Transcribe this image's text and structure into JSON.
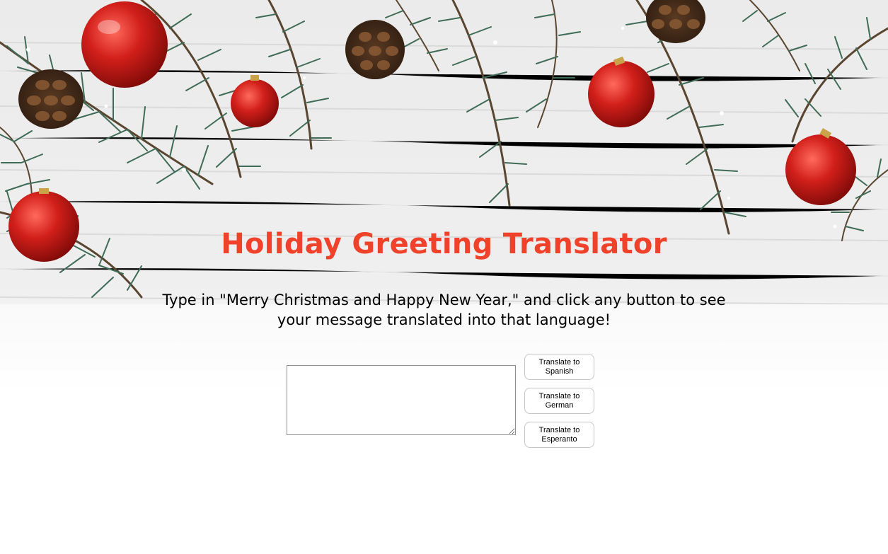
{
  "title": "Holiday Greeting Translator",
  "instructions": "Type in \"Merry Christmas and Happy New Year,\" and click any button to see your message translated into that language!",
  "message_input": {
    "value": "",
    "placeholder": ""
  },
  "buttons": [
    {
      "label": "Translate to Spanish"
    },
    {
      "label": "Translate to German"
    },
    {
      "label": "Translate to Esperanto"
    }
  ],
  "colors": {
    "title": "#f0422b",
    "ornament": "#d21f1a",
    "pine": "#3f6b57",
    "wood": "#f2f2f2"
  },
  "decorations": [
    "pine-branch",
    "red-ornament",
    "pine-cone"
  ]
}
